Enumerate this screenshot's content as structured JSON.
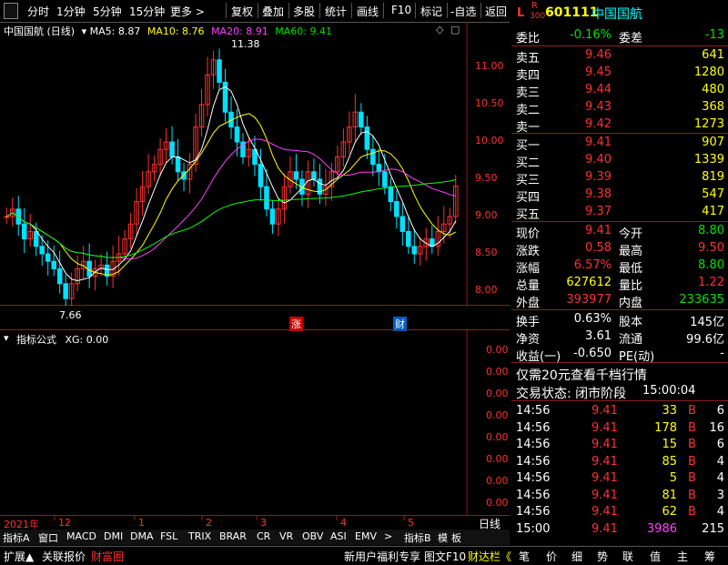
{
  "menu": {
    "items": [
      "分时",
      "1分钟",
      "5分钟",
      "15分钟",
      "更多 >",
      "复权",
      "叠加",
      "多股",
      "统计",
      "画线",
      "F10",
      "标记",
      "-自选",
      "返回"
    ]
  },
  "chart": {
    "stock_label": "中国国航 (日线)",
    "ma5_label": "MA5: 8.87",
    "ma10_label": "MA10: 8.76",
    "ma20_label": "MA20: 8.91",
    "ma60_label": "MA60: 9.41",
    "high_marker": "11.38",
    "low_marker": "7.66",
    "event_rise": "涨",
    "event_fin": "财",
    "y_ticks": [
      "11.00",
      "10.50",
      "10.00",
      "9.50",
      "9.00",
      "8.50",
      "8.00"
    ],
    "colors": {
      "up": "#ff3030",
      "down": "#00e0ff",
      "ma5": "#ffffff",
      "ma10": "#ffff00",
      "ma20": "#ff40ff",
      "ma60": "#00ff00"
    }
  },
  "indicator": {
    "title": "指标公式",
    "xg": "XG: 0.00",
    "y_ticks": [
      "0.00",
      "0.00",
      "0.00",
      "0.00",
      "0.00",
      "0.00",
      "0.00",
      "0.00",
      "0.00"
    ]
  },
  "xaxis": {
    "labels": [
      "2021年",
      "12",
      "1",
      "2",
      "3",
      "4",
      "5"
    ],
    "period": "日线"
  },
  "tabs": {
    "items": [
      "指标A",
      "窗口",
      "MACD",
      "DMI",
      "DMA",
      "FSL",
      "TRIX",
      "BRAR",
      "CR",
      "VR",
      "OBV",
      "ASI",
      "EMV",
      ">",
      "指标B",
      "模",
      "板"
    ]
  },
  "bottom": {
    "items": [
      "扩展▲",
      "关联报价",
      "财富圈",
      "新用户福利专享",
      "图文F10",
      "财达栏《",
      "笔",
      "价",
      "细",
      "势",
      "联",
      "值",
      "主",
      "筹"
    ]
  },
  "quote": {
    "logo_l": "L",
    "logo_r": "R",
    "logo_300": "300",
    "code": "601111",
    "name": "中国国航",
    "weibi_label": "委比",
    "weibi_value": "-0.16%",
    "weicha_label": "委差",
    "weicha_value": "-13",
    "asks": [
      {
        "label": "卖五",
        "price": "9.46",
        "vol": "641"
      },
      {
        "label": "卖四",
        "price": "9.45",
        "vol": "1280"
      },
      {
        "label": "卖三",
        "price": "9.44",
        "vol": "480"
      },
      {
        "label": "卖二",
        "price": "9.43",
        "vol": "368"
      },
      {
        "label": "卖一",
        "price": "9.42",
        "vol": "1273"
      }
    ],
    "bids": [
      {
        "label": "买一",
        "price": "9.41",
        "vol": "907"
      },
      {
        "label": "买二",
        "price": "9.40",
        "vol": "1339"
      },
      {
        "label": "买三",
        "price": "9.39",
        "vol": "819"
      },
      {
        "label": "买四",
        "price": "9.38",
        "vol": "547"
      },
      {
        "label": "买五",
        "price": "9.37",
        "vol": "417"
      }
    ],
    "stats": [
      {
        "l1": "现价",
        "v1": "9.41",
        "c1": "red",
        "l2": "今开",
        "v2": "8.80",
        "c2": "green"
      },
      {
        "l1": "涨跌",
        "v1": "0.58",
        "c1": "red",
        "l2": "最高",
        "v2": "9.50",
        "c2": "red"
      },
      {
        "l1": "涨幅",
        "v1": "6.57%",
        "c1": "red",
        "l2": "最低",
        "v2": "8.80",
        "c2": "green"
      },
      {
        "l1": "总量",
        "v1": "627612",
        "c1": "yellow",
        "l2": "量比",
        "v2": "1.22",
        "c2": "red"
      },
      {
        "l1": "外盘",
        "v1": "393977",
        "c1": "red",
        "l2": "内盘",
        "v2": "233635",
        "c2": "green"
      }
    ],
    "stats2": [
      {
        "l1": "换手",
        "v1": "0.63%",
        "l2": "股本",
        "v2": "145亿"
      },
      {
        "l1": "净资",
        "v1": "3.61",
        "l2": "流通",
        "v2": "99.6亿"
      },
      {
        "l1": "收益(一)",
        "v1": "-0.650",
        "l2": "PE(动)",
        "v2": "-"
      }
    ],
    "promo": "仅需20元查看千档行情",
    "status_label": "交易状态: 闭市阶段",
    "status_time": "15:00:04",
    "trades": [
      {
        "time": "14:56",
        "price": "9.41",
        "vol": "33",
        "dir": "B",
        "n": "6"
      },
      {
        "time": "14:56",
        "price": "9.41",
        "vol": "178",
        "dir": "B",
        "n": "16"
      },
      {
        "time": "14:56",
        "price": "9.41",
        "vol": "15",
        "dir": "B",
        "n": "6"
      },
      {
        "time": "14:56",
        "price": "9.41",
        "vol": "85",
        "dir": "B",
        "n": "4"
      },
      {
        "time": "14:56",
        "price": "9.41",
        "vol": "5",
        "dir": "B",
        "n": "4"
      },
      {
        "time": "14:56",
        "price": "9.41",
        "vol": "81",
        "dir": "B",
        "n": "3"
      },
      {
        "time": "14:56",
        "price": "9.41",
        "vol": "62",
        "dir": "B",
        "n": "4"
      },
      {
        "time": "15:00",
        "price": "9.41",
        "vol": "3986",
        "dir": "",
        "n": "215"
      }
    ]
  }
}
